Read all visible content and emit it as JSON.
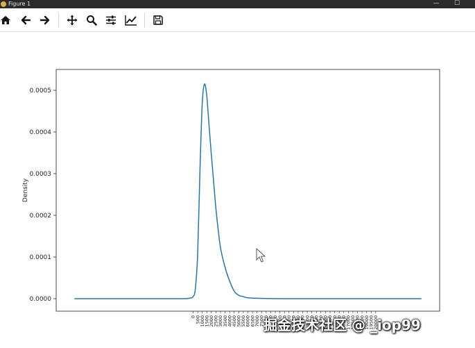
{
  "window": {
    "title": "Figure 1",
    "minimize_glyph": "—",
    "maximize_glyph": "☐"
  },
  "toolbar": {
    "buttons": [
      {
        "name": "home",
        "icon": "home-icon"
      },
      {
        "name": "back",
        "icon": "arrow-left-icon"
      },
      {
        "name": "forward",
        "icon": "arrow-right-icon"
      },
      {
        "name": "pan",
        "icon": "move-arrows-icon"
      },
      {
        "name": "zoom",
        "icon": "magnifier-icon"
      },
      {
        "name": "configure-subplots",
        "icon": "sliders-icon"
      },
      {
        "name": "edit-axis",
        "icon": "line-chart-icon"
      },
      {
        "name": "save",
        "icon": "floppy-disk-icon"
      }
    ]
  },
  "chart_data": {
    "type": "line",
    "ylabel": "Density",
    "xlim": [
      -15000,
      27000
    ],
    "ylim": [
      -3e-05,
      0.00055
    ],
    "yticks": [
      0.0,
      0.0001,
      0.0002,
      0.0003,
      0.0004,
      0.0005
    ],
    "ytick_labels": [
      "0.0000",
      "0.0001",
      "0.0002",
      "0.0003",
      "0.0004",
      "0.0005"
    ],
    "xticks": [
      0,
      500,
      1000,
      1500,
      2000,
      2500,
      3000,
      3500,
      4000,
      4500,
      5000,
      5500,
      6000,
      6500,
      7000,
      7500,
      8000,
      8500,
      9000,
      9500,
      10000,
      10500,
      11000,
      11500,
      12000,
      12500,
      13000,
      13500,
      14000,
      14500,
      15000,
      15500,
      16000,
      16500,
      17000,
      17500,
      18000,
      18500,
      19000,
      19500,
      20000
    ],
    "xtick_labels": [
      "0",
      "500",
      "1000",
      "1500",
      "2000",
      "2500",
      "3000",
      "3500",
      "4000",
      "4500",
      "5000",
      "5500",
      "6000",
      "6500",
      "7000",
      "7500",
      "8000",
      "8500",
      "9000",
      "9500",
      "10000",
      "10500",
      "11000",
      "11500",
      "12000",
      "12500",
      "13000",
      "13500",
      "14000",
      "14500",
      "15000",
      "15500",
      "16000",
      "16500",
      "17000",
      "17500",
      "18000",
      "18500",
      "19000",
      "19500",
      "20000"
    ],
    "series": [
      {
        "color": "#1f77b4",
        "x": [
          -13000,
          -2000,
          -500,
          0,
          250,
          500,
          750,
          1000,
          1250,
          1500,
          1750,
          2000,
          2250,
          2500,
          2750,
          3000,
          3500,
          4000,
          4500,
          5000,
          5500,
          6000,
          7000,
          8000,
          10000,
          13000,
          17000,
          21000,
          25000
        ],
        "y": [
          0.0,
          0.0,
          1e-06,
          5e-06,
          2.5e-05,
          0.00011,
          0.00031,
          0.00047,
          0.000515,
          0.000485,
          0.000415,
          0.000345,
          0.00028,
          0.000215,
          0.000165,
          0.000122,
          7.5e-05,
          4.2e-05,
          1.8e-05,
          8e-06,
          5e-06,
          2e-06,
          1e-06,
          5e-07,
          0.0,
          0.0,
          0.0,
          0.0,
          0.0
        ]
      }
    ],
    "grid": false
  },
  "overlay": {
    "watermark": "掘金技术社区 @ _iop99"
  }
}
